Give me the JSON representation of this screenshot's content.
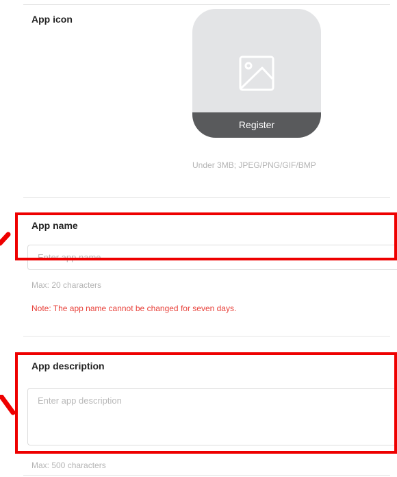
{
  "app_icon": {
    "label": "App icon",
    "upload_button_label": "Register",
    "icon": "image-placeholder-icon",
    "hint": "Under 3MB; JPEG/PNG/GIF/BMP"
  },
  "app_name": {
    "label": "App name",
    "value": "",
    "placeholder": "Enter app name",
    "max_hint": "Max: 20 characters",
    "note": "Note: The app name cannot be changed for seven days."
  },
  "app_description": {
    "label": "App description",
    "value": "",
    "placeholder": "Enter app description",
    "max_hint": "Max: 500 characters"
  },
  "colors": {
    "annotation": "#ee0000",
    "note_text": "#e8413a",
    "register_bar": "#595a5c",
    "icon_box": "#e3e4e6"
  }
}
